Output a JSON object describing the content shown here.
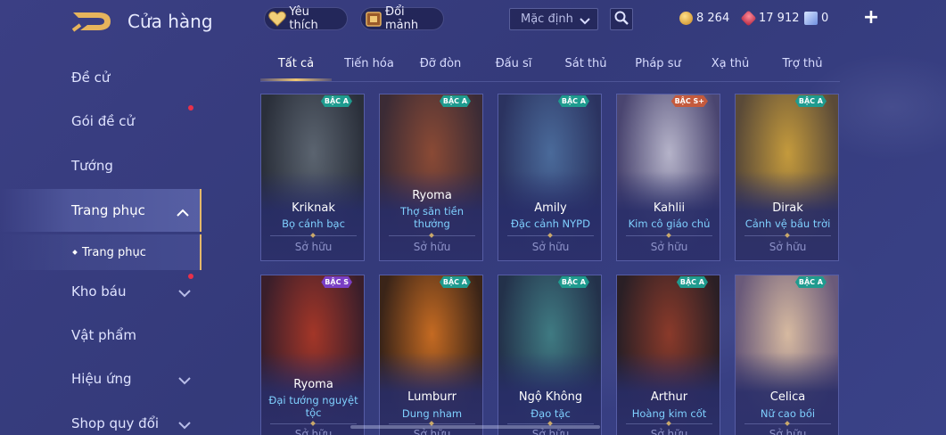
{
  "header": {
    "title": "Cửa hàng",
    "favorite_label": "Yêu thích",
    "exchange_label": "Đổi mảnh",
    "sort_selected": "Mặc định",
    "currencies": [
      {
        "icon": "gold-coin-icon",
        "value": "8 264",
        "color": "#e3a43a"
      },
      {
        "icon": "ruby-icon",
        "value": "17 912",
        "color": "#e0425a"
      },
      {
        "icon": "voucher-icon",
        "value": "0",
        "color": "#9fc2ff"
      }
    ]
  },
  "sidebar": {
    "items": [
      {
        "label": "Đề cử"
      },
      {
        "label": "Gói đề cử"
      },
      {
        "label": "Tướng"
      },
      {
        "label": "Trang phục"
      },
      {
        "label": "Trang phục"
      },
      {
        "label": "Kho báu"
      },
      {
        "label": "Vật phẩm"
      },
      {
        "label": "Hiệu ứng"
      },
      {
        "label": "Shop quy đổi"
      }
    ]
  },
  "tabs": [
    {
      "label": "Tất cả"
    },
    {
      "label": "Tiến hóa"
    },
    {
      "label": "Đỡ đòn"
    },
    {
      "label": "Đấu sĩ"
    },
    {
      "label": "Sát thủ"
    },
    {
      "label": "Pháp sư"
    },
    {
      "label": "Xạ thủ"
    },
    {
      "label": "Trợ thủ"
    }
  ],
  "cards": [
    {
      "hero": "Kriknak",
      "skin": "Bọ cánh bạc",
      "tier": "BẬC A",
      "status": "Sở hữu",
      "colors": [
        "#5b6470",
        "#2a2f3a"
      ]
    },
    {
      "hero": "Ryoma",
      "skin": "Thợ săn tiền thưởng",
      "tier": "BẬC A",
      "status": "Sở hữu",
      "colors": [
        "#8a4a35",
        "#3b2b35"
      ]
    },
    {
      "hero": "Amily",
      "skin": "Đặc cảnh NYPD",
      "tier": "BẬC A",
      "status": "Sở hữu",
      "colors": [
        "#4a6a9a",
        "#2b3360"
      ]
    },
    {
      "hero": "Kahlii",
      "skin": "Kim cô giáo chủ",
      "tier": "BẬC S+",
      "status": "Sở hữu",
      "colors": [
        "#b5b3c9",
        "#4a4570"
      ]
    },
    {
      "hero": "Dirak",
      "skin": "Cảnh vệ bầu trời",
      "tier": "BẬC A",
      "status": "Sở hữu",
      "colors": [
        "#c49a3c",
        "#5a4a38"
      ]
    },
    {
      "hero": "Ryoma",
      "skin": "Đại tướng nguyệt tộc",
      "tier": "BẬC S",
      "status": "Sở hữu",
      "colors": [
        "#a33628",
        "#3a1e2a"
      ]
    },
    {
      "hero": "Lumburr",
      "skin": "Dung nham",
      "tier": "BẬC A",
      "status": "Sở hữu",
      "colors": [
        "#c46a22",
        "#3a2418"
      ]
    },
    {
      "hero": "Ngộ Không",
      "skin": "Đạo tặc",
      "tier": "BẬC A",
      "status": "Sở hữu",
      "colors": [
        "#3f7a82",
        "#23314a"
      ]
    },
    {
      "hero": "Arthur",
      "skin": "Hoàng kim cốt",
      "tier": "BẬC A",
      "status": "Sở hữu",
      "colors": [
        "#8a3a2a",
        "#2a1f25"
      ]
    },
    {
      "hero": "Celica",
      "skin": "Nữ cao bồi",
      "tier": "BẬC A",
      "status": "Sở hữu",
      "colors": [
        "#d6b9a0",
        "#6a5a7a"
      ]
    }
  ]
}
